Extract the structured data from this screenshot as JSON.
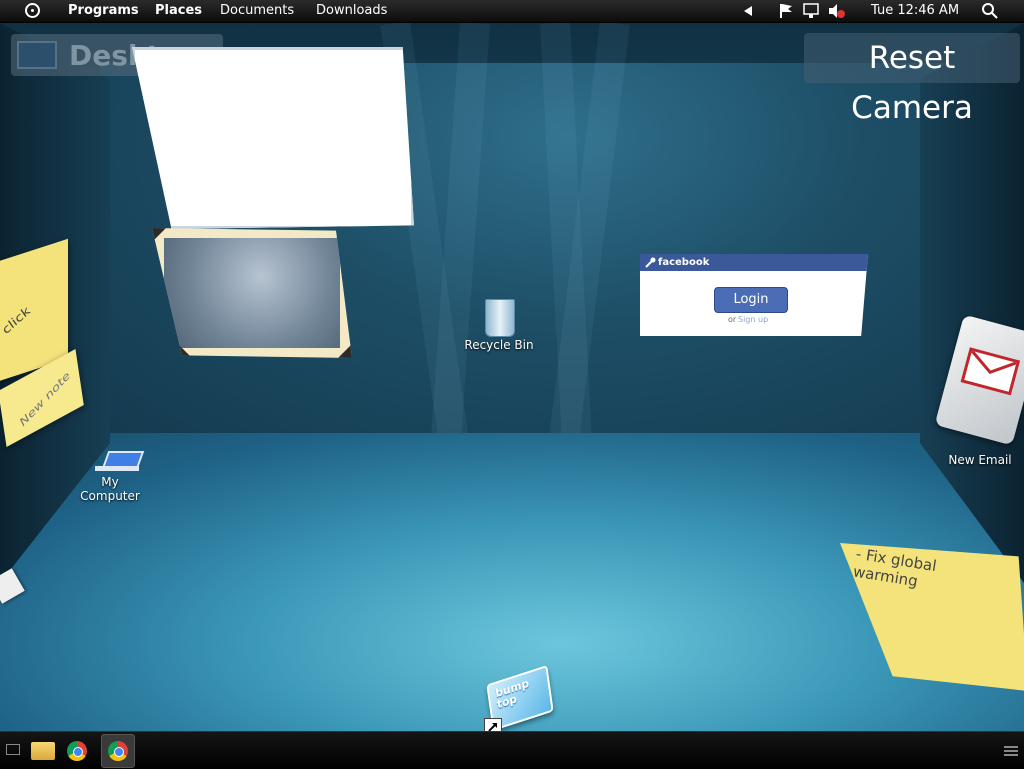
{
  "topbar": {
    "menus": [
      "Programs",
      "Places",
      "Documents",
      "Downloads"
    ],
    "clock": "Tue 12:46 AM",
    "icons": [
      "gnome-foot-icon",
      "tray-arrow-icon",
      "flag-icon",
      "network-icon",
      "volume-muted-icon",
      "search-icon"
    ]
  },
  "desktop_label": {
    "text": "Desktop"
  },
  "reset_camera": {
    "label": "Reset Camera"
  },
  "icons": {
    "recycle_bin": "Recycle Bin",
    "my_computer": "My\nComputer",
    "new_email": "New Email"
  },
  "facebook": {
    "header": "facebook",
    "login_label": "Login",
    "or_text": "or",
    "signup_text": "Sign up"
  },
  "notes": {
    "click_note": "click",
    "new_note": "New note",
    "fix_note": "- Fix global warming"
  },
  "bumptop_logo": "bump top",
  "taskbar": {
    "items": [
      "show-desktop-icon",
      "file-manager-icon",
      "chrome-icon",
      "chrome-icon",
      "menu-icon"
    ]
  },
  "colors": {
    "facebook_blue": "#3b5998",
    "sticky_yellow": "#f4e27a",
    "email_red": "#c0262c"
  }
}
